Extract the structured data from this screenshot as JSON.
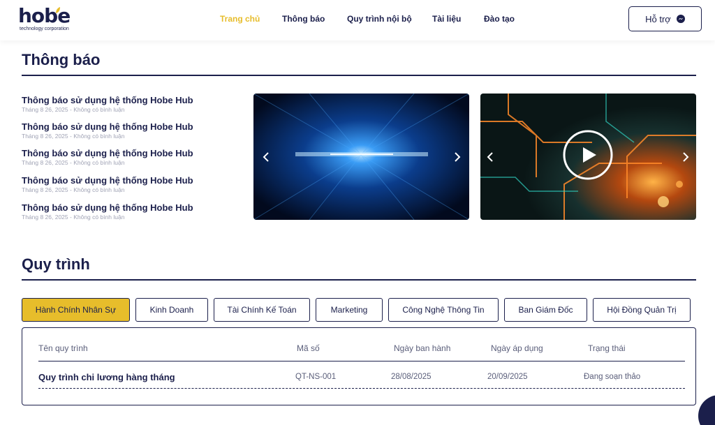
{
  "logo": {
    "word": "hobe",
    "tagline": "technology corporation"
  },
  "nav": [
    {
      "label": "Trang chủ",
      "active": true
    },
    {
      "label": "Thông báo",
      "active": false
    },
    {
      "label": "Quy trình nội bộ",
      "active": false
    },
    {
      "label": "Tài liệu",
      "active": false
    },
    {
      "label": "Đào tạo",
      "active": false
    }
  ],
  "support": {
    "label": "Hỗ trợ",
    "icon": "messenger-icon"
  },
  "notices": {
    "title": "Thông báo",
    "items": [
      {
        "title": "Thông báo sử dụng hệ thống Hobe Hub",
        "meta": "Tháng 8 26, 2025 - Không có bình luận"
      },
      {
        "title": "Thông báo sử dụng hệ thống Hobe Hub",
        "meta": "Tháng 8 26, 2025 - Không có bình luận"
      },
      {
        "title": "Thông báo sử dụng hệ thống Hobe Hub",
        "meta": "Tháng 8 26, 2025 - Không có bình luận"
      },
      {
        "title": "Thông báo sử dụng hệ thống Hobe Hub",
        "meta": "Tháng 8 26, 2025 - Không có bình luận"
      },
      {
        "title": "Thông báo sử dụng hệ thống Hobe Hub",
        "meta": "Tháng 8 26, 2025 - Không có bình luận"
      }
    ]
  },
  "process": {
    "title": "Quy trình",
    "tabs": [
      {
        "label": "Hành Chính Nhân Sự",
        "active": true
      },
      {
        "label": "Kinh Doanh",
        "active": false
      },
      {
        "label": "Tài Chính Kế Toán",
        "active": false
      },
      {
        "label": "Marketing",
        "active": false
      },
      {
        "label": "Công Nghệ Thông Tin",
        "active": false
      },
      {
        "label": "Ban Giám Đốc",
        "active": false
      },
      {
        "label": "Hội Đồng Quản Trị",
        "active": false
      }
    ],
    "table": {
      "headers": [
        "Tên quy trình",
        "Mã số",
        "Ngày ban hành",
        "Ngày áp dụng",
        "Trạng thái"
      ],
      "rows": [
        [
          "Quy trình chi lương hàng tháng",
          "QT-NS-001",
          "28/08/2025",
          "20/09/2025",
          "Đang soạn thảo"
        ]
      ]
    }
  },
  "colors": {
    "brand": "#1b1f4b",
    "accent": "#e7bd2b",
    "muted": "#a0a3b5"
  }
}
